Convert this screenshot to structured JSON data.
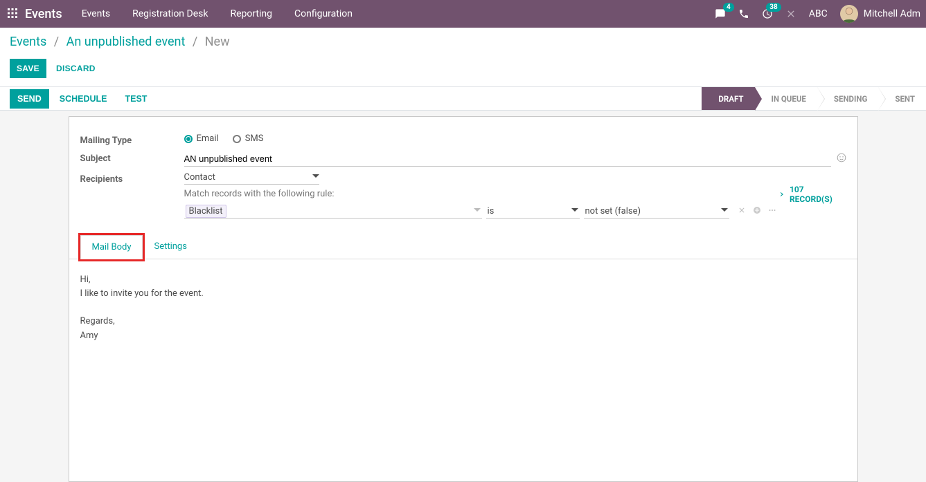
{
  "navbar": {
    "brand": "Events",
    "menu": [
      "Events",
      "Registration Desk",
      "Reporting",
      "Configuration"
    ],
    "messages_badge": "4",
    "activities_badge": "38",
    "db_name": "ABC",
    "user_name": "Mitchell Adm"
  },
  "breadcrumb": {
    "root": "Events",
    "parent": "An unpublished event",
    "current": "New"
  },
  "buttons": {
    "save": "SAVE",
    "discard": "DISCARD",
    "send": "SEND",
    "schedule": "SCHEDULE",
    "test": "TEST"
  },
  "steps": [
    "DRAFT",
    "IN QUEUE",
    "SENDING",
    "SENT"
  ],
  "form": {
    "mailing_type_label": "Mailing Type",
    "email_opt": "Email",
    "sms_opt": "SMS",
    "subject_label": "Subject",
    "subject_value": "AN unpublished event",
    "recipients_label": "Recipients",
    "recipients_value": "Contact",
    "rule_intro": "Match records with the following rule:",
    "rule_field": "Blacklist",
    "rule_op": "is",
    "rule_val": "not set (false)",
    "records_count": "107 RECORD(S)"
  },
  "tabs": {
    "mail_body": "Mail Body",
    "settings": "Settings"
  },
  "mail_body": {
    "line1": "Hi,",
    "line2": "I like to invite you for the event.",
    "line3": "Regards,",
    "line4": "Amy"
  }
}
